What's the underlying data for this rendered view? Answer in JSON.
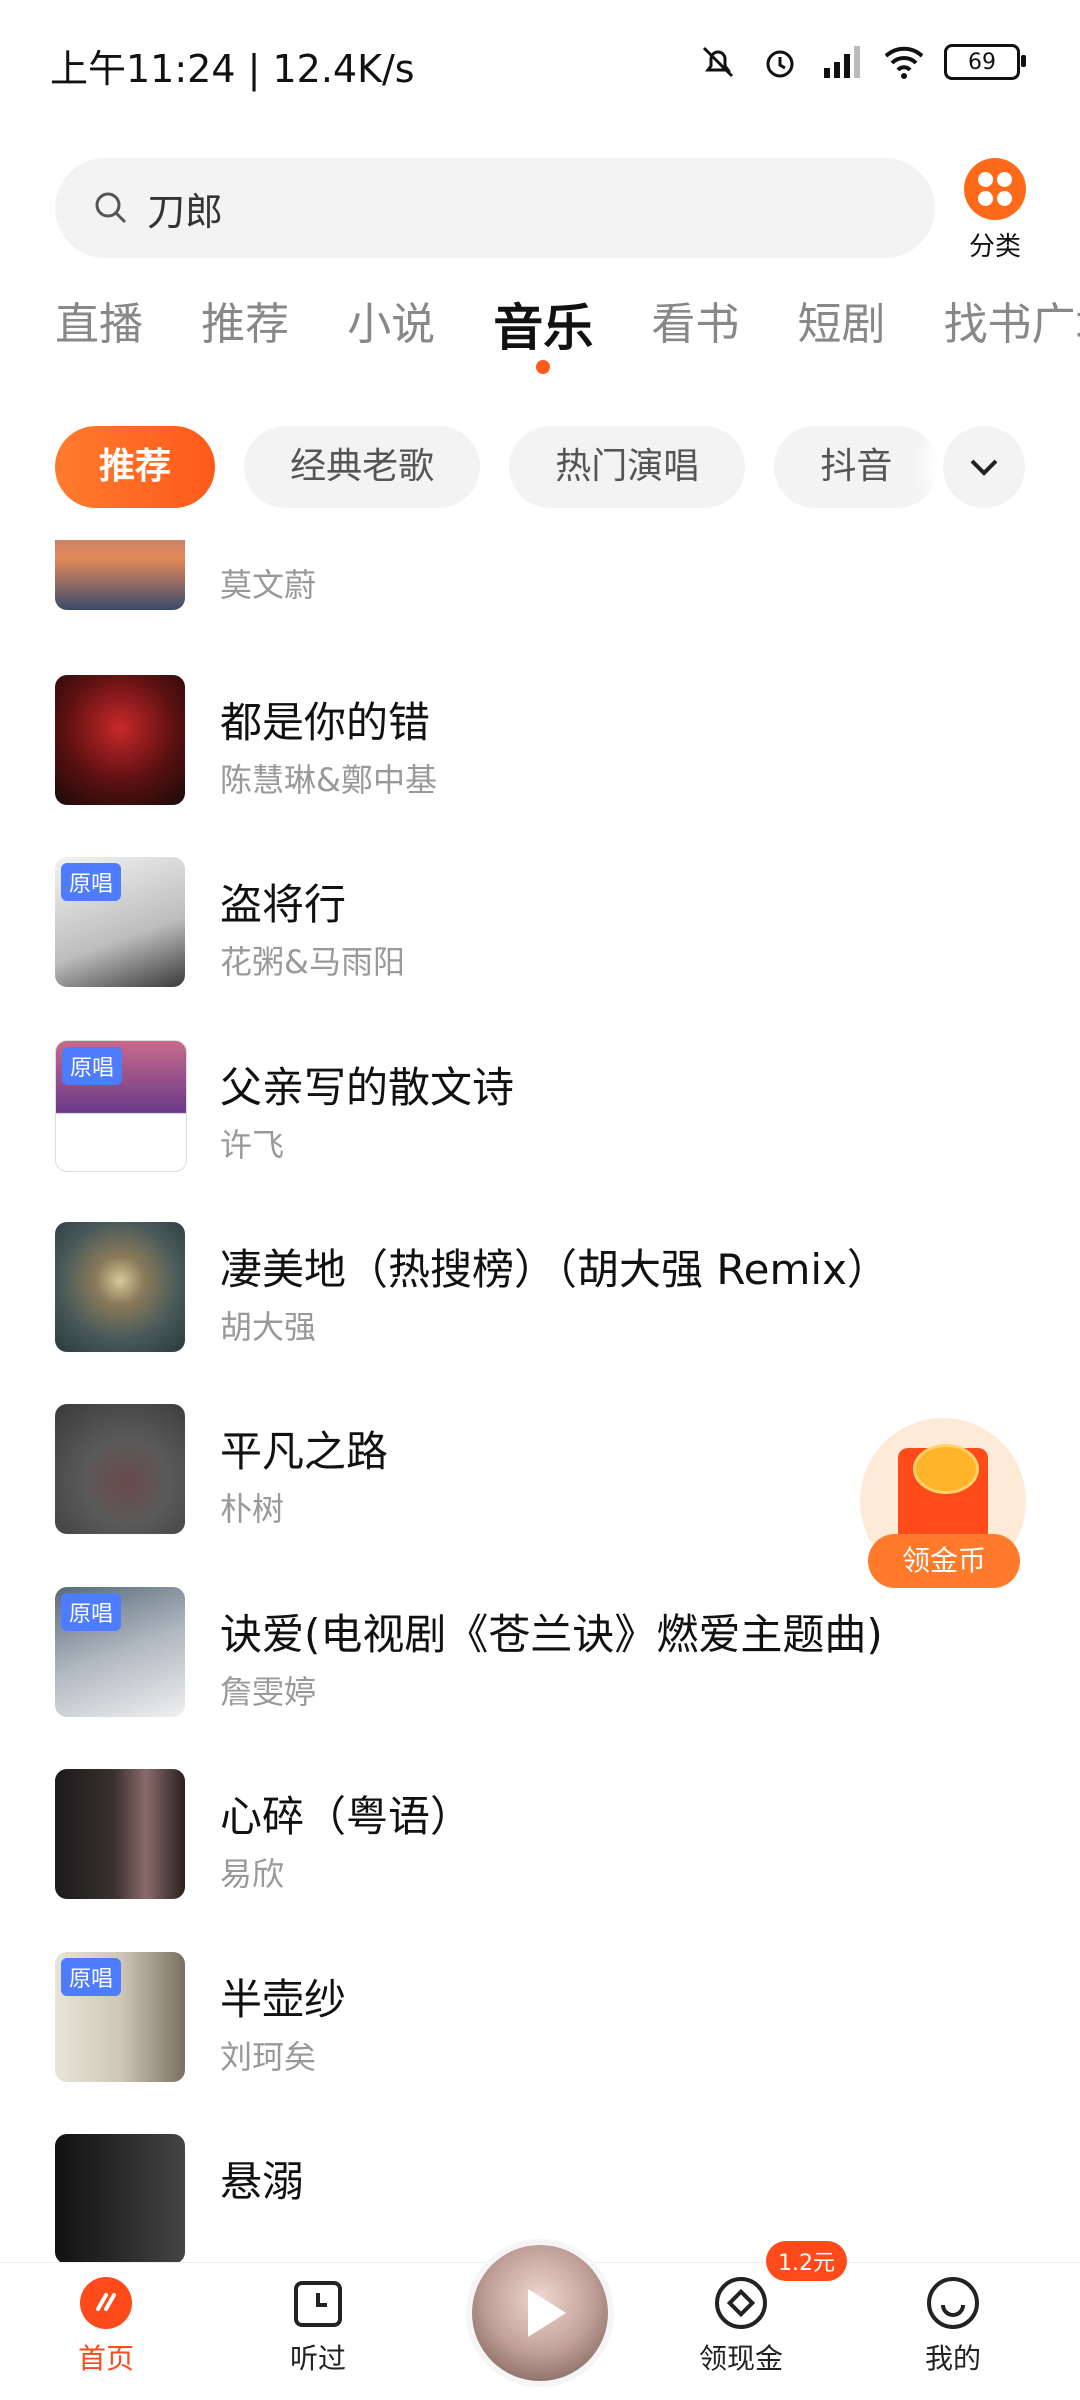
{
  "status_bar": {
    "time": "上午11:24 | 12.4K/s",
    "battery": "69"
  },
  "search": {
    "query": "刀郎"
  },
  "category_button": {
    "label": "分类"
  },
  "main_tabs": [
    {
      "label": "直播"
    },
    {
      "label": "推荐"
    },
    {
      "label": "小说"
    },
    {
      "label": "音乐",
      "active": true
    },
    {
      "label": "看书"
    },
    {
      "label": "短剧"
    },
    {
      "label": "找书广场"
    }
  ],
  "filter_chips": [
    {
      "label": "推荐",
      "active": true
    },
    {
      "label": "经典老歌"
    },
    {
      "label": "热门演唱"
    },
    {
      "label": "抖音"
    }
  ],
  "songs": [
    {
      "title": "",
      "artist": "莫文蔚",
      "badge": ""
    },
    {
      "title": "都是你的错",
      "artist": "陈慧琳&鄭中基",
      "badge": ""
    },
    {
      "title": "盗将行",
      "artist": "花粥&马雨阳",
      "badge": "原唱"
    },
    {
      "title": "父亲写的散文诗",
      "artist": "许飞",
      "badge": "原唱"
    },
    {
      "title": "凄美地（热搜榜）（胡大强 Remix）",
      "artist": "胡大强",
      "badge": ""
    },
    {
      "title": "平凡之路",
      "artist": "朴树",
      "badge": ""
    },
    {
      "title": "诀爱(电视剧《苍兰诀》燃爱主题曲)",
      "artist": "詹雯婷",
      "badge": "原唱"
    },
    {
      "title": "心碎（粤语）",
      "artist": "易欣",
      "badge": ""
    },
    {
      "title": "半壶纱",
      "artist": "刘珂矣",
      "badge": "原唱"
    },
    {
      "title": "悬溺",
      "artist": "",
      "badge": ""
    }
  ],
  "floating_reward": {
    "label": "领金币"
  },
  "bottom_nav": {
    "home": "首页",
    "history": "听过",
    "cash": "领现金",
    "cash_badge": "1.2元",
    "mine": "我的"
  },
  "colors": {
    "accent": "#ff5a1a",
    "badge_blue": "#4d7cff"
  }
}
